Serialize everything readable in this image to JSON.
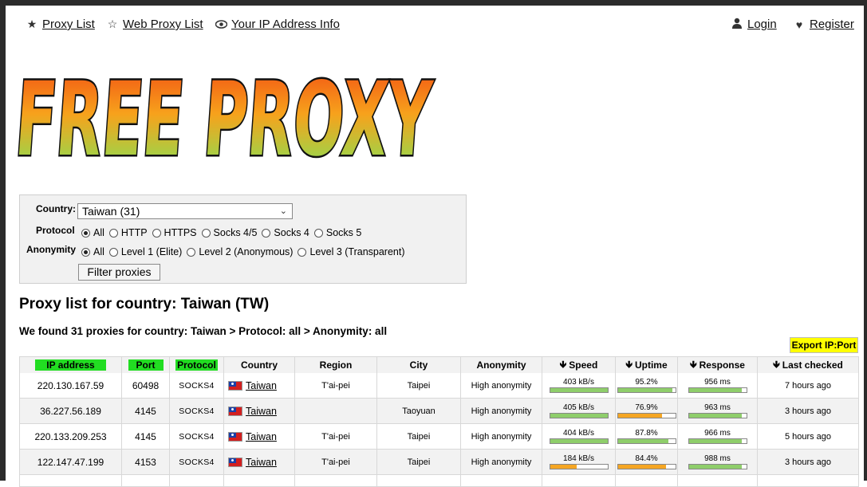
{
  "nav": {
    "proxy_list": "Proxy List",
    "web_proxy_list": "Web Proxy List",
    "ip_info": "Your IP Address Info",
    "login": "Login",
    "register": "Register"
  },
  "logo": {
    "text": "FREE PROXY"
  },
  "filter": {
    "country_label": "Country:",
    "country_value": "Taiwan (31)",
    "protocol_label": "Protocol",
    "protocol_options": [
      "All",
      "HTTP",
      "HTTPS",
      "Socks 4/5",
      "Socks 4",
      "Socks 5"
    ],
    "protocol_selected": "All",
    "anonymity_label": "Anonymity",
    "anonymity_options": [
      "All",
      "Level 1 (Elite)",
      "Level 2 (Anonymous)",
      "Level 3 (Transparent)"
    ],
    "anonymity_selected": "All",
    "button": "Filter proxies"
  },
  "title": "Proxy list for country: Taiwan (TW)",
  "found": "We found 31 proxies for country: Taiwan > Protocol: all > Anonymity: all",
  "export": "Export IP:Port",
  "table": {
    "headers": [
      "IP address",
      "Port",
      "Protocol",
      "Country",
      "Region",
      "City",
      "Anonymity",
      "Speed",
      "Uptime",
      "Response",
      "Last checked"
    ],
    "rows": [
      {
        "ip": "220.130.167.59",
        "port": "60498",
        "protocol": "SOCKS4",
        "country": "Taiwan",
        "region": "T'ai-pei",
        "city": "Taipei",
        "anonymity": "High anonymity",
        "speed": "403 kB/s",
        "speed_pct": 1.0,
        "speed_color": "green",
        "uptime": "95.2%",
        "uptime_pct": 0.952,
        "uptime_color": "green",
        "response": "956 ms",
        "response_pct": 0.92,
        "response_color": "green",
        "checked": "7 hours ago"
      },
      {
        "ip": "36.227.56.189",
        "port": "4145",
        "protocol": "SOCKS4",
        "country": "Taiwan",
        "region": "",
        "city": "Taoyuan",
        "anonymity": "High anonymity",
        "speed": "405 kB/s",
        "speed_pct": 1.0,
        "speed_color": "green",
        "uptime": "76.9%",
        "uptime_pct": 0.769,
        "uptime_color": "orange",
        "response": "963 ms",
        "response_pct": 0.92,
        "response_color": "green",
        "checked": "3 hours ago"
      },
      {
        "ip": "220.133.209.253",
        "port": "4145",
        "protocol": "SOCKS4",
        "country": "Taiwan",
        "region": "T'ai-pei",
        "city": "Taipei",
        "anonymity": "High anonymity",
        "speed": "404 kB/s",
        "speed_pct": 1.0,
        "speed_color": "green",
        "uptime": "87.8%",
        "uptime_pct": 0.878,
        "uptime_color": "green",
        "response": "966 ms",
        "response_pct": 0.92,
        "response_color": "green",
        "checked": "5 hours ago"
      },
      {
        "ip": "122.147.47.199",
        "port": "4153",
        "protocol": "SOCKS4",
        "country": "Taiwan",
        "region": "T'ai-pei",
        "city": "Taipei",
        "anonymity": "High anonymity",
        "speed": "184 kB/s",
        "speed_pct": 0.46,
        "speed_color": "orange",
        "uptime": "84.4%",
        "uptime_pct": 0.844,
        "uptime_color": "orange",
        "response": "988 ms",
        "response_pct": 0.92,
        "response_color": "green",
        "checked": "3 hours ago"
      }
    ]
  }
}
